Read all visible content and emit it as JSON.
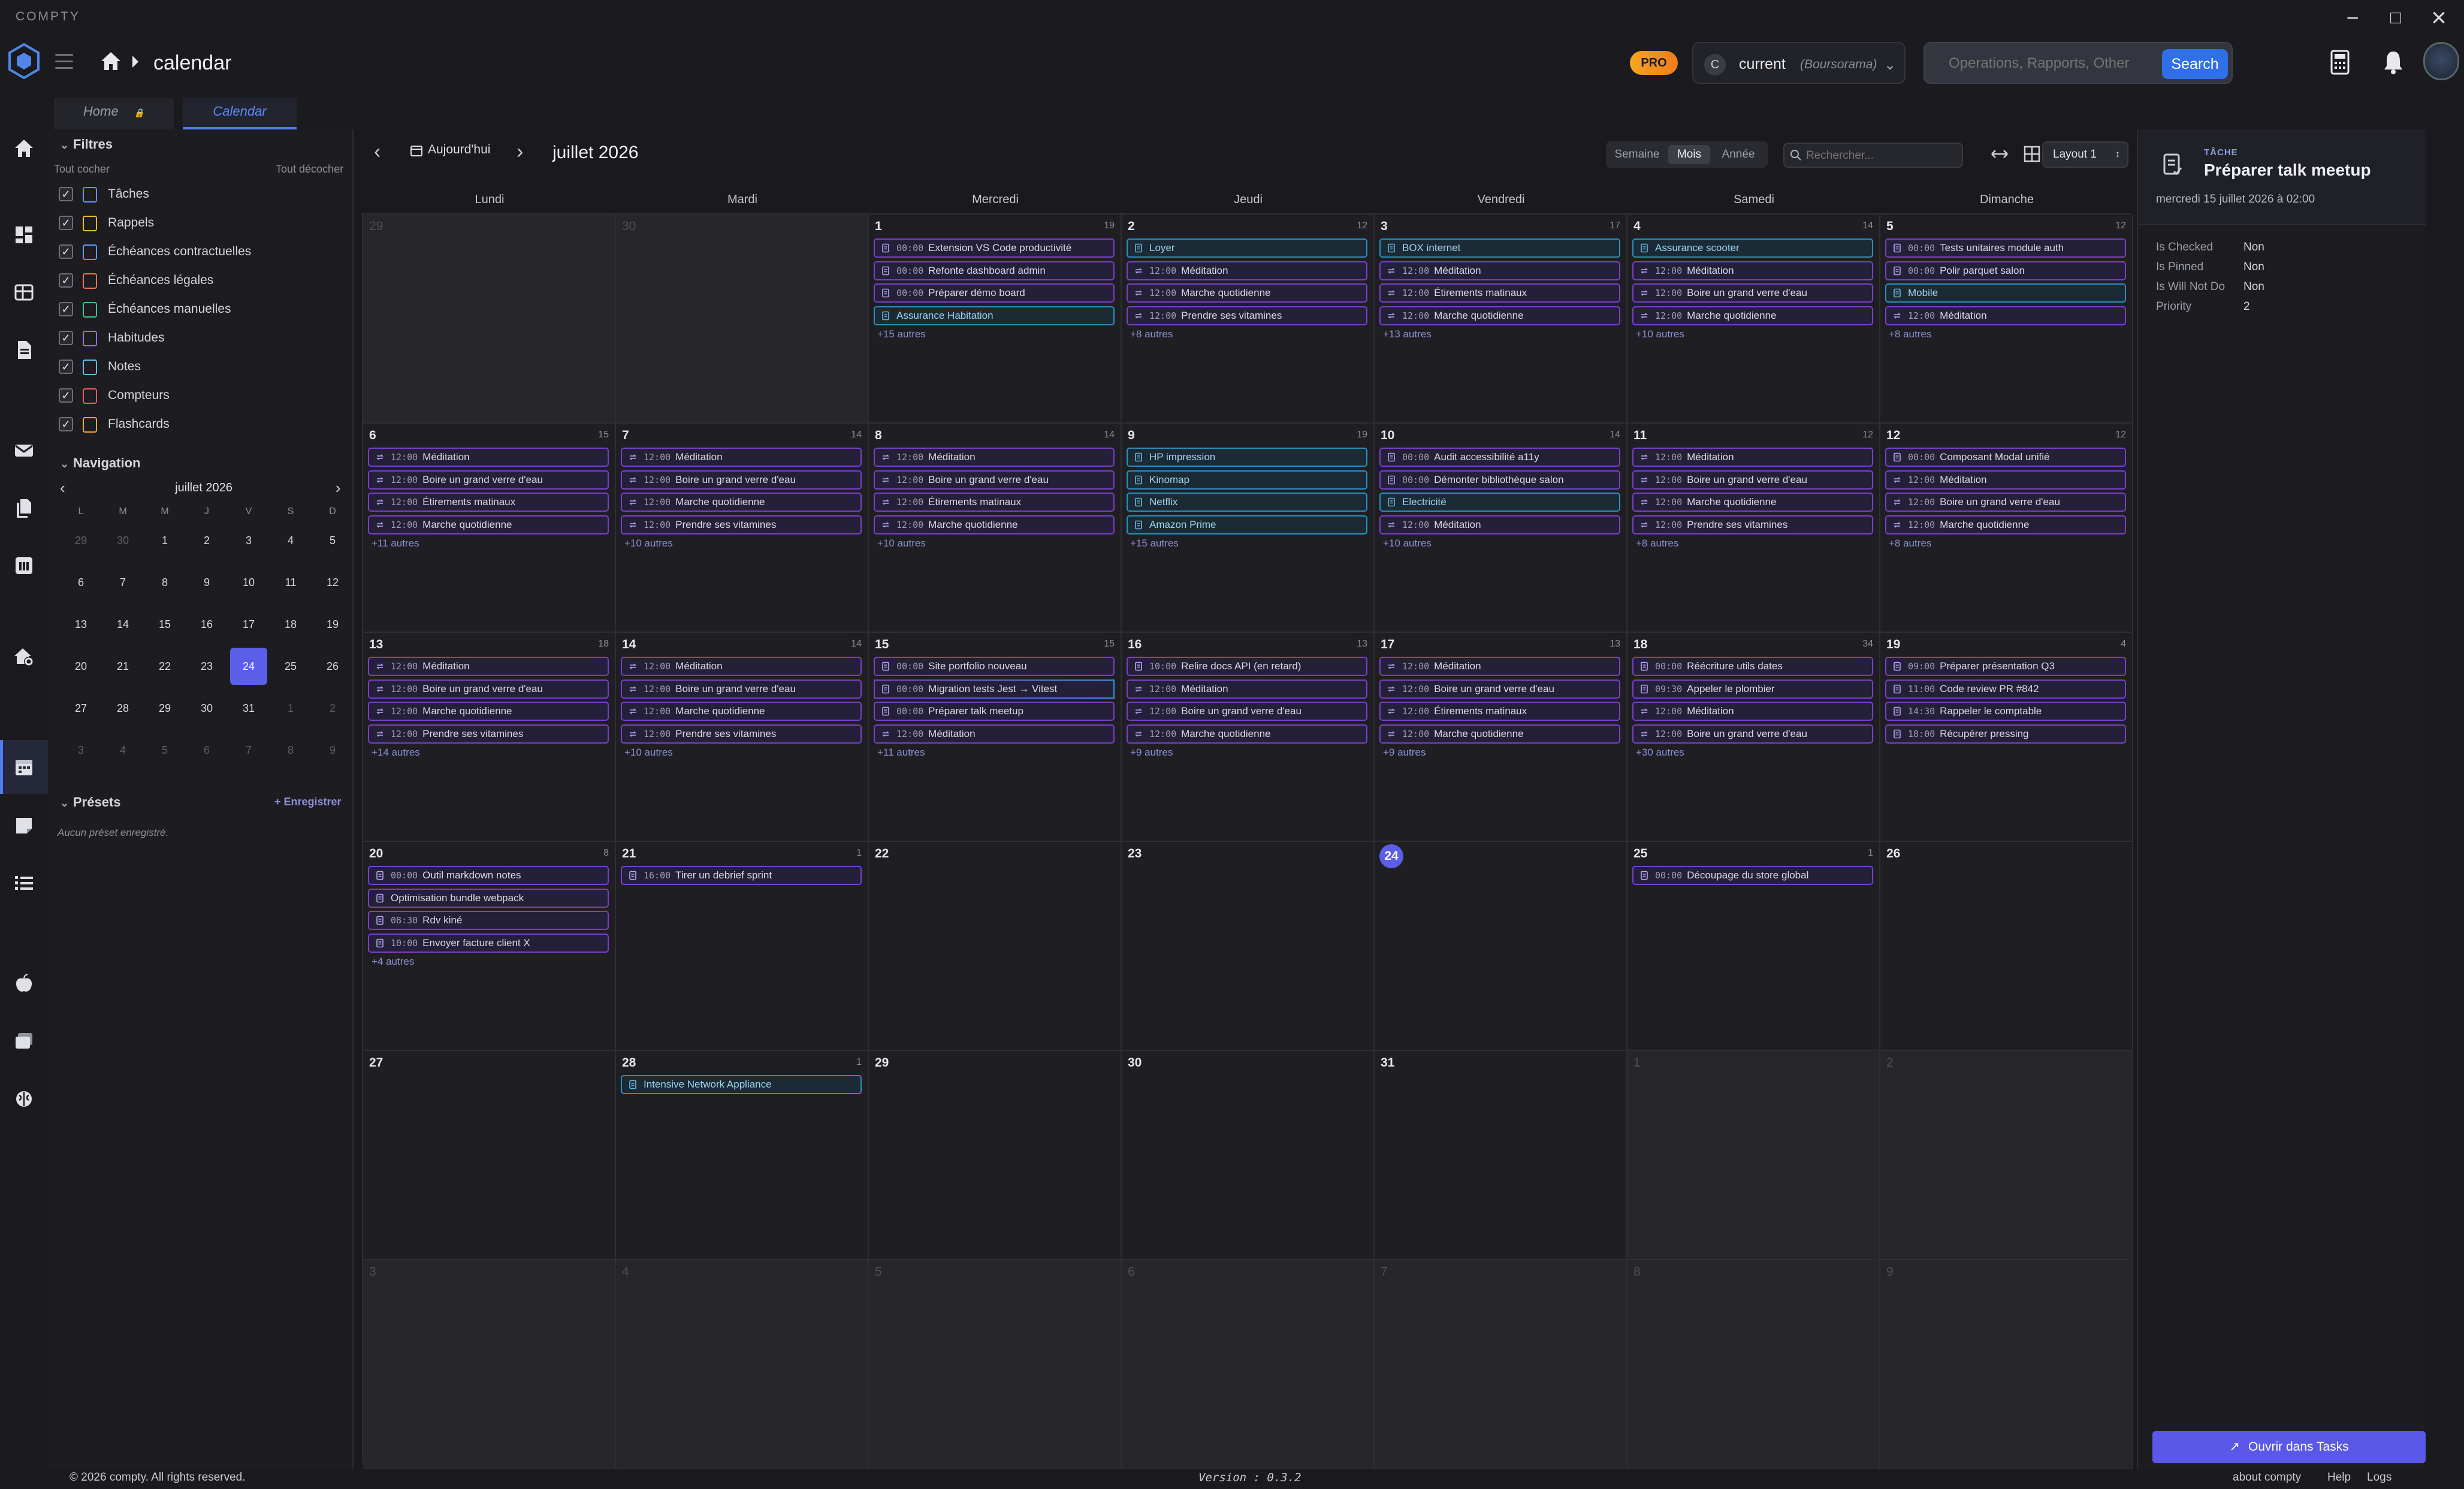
{
  "window": {
    "title": "COMPTY",
    "minimize": "−",
    "maximize": "□",
    "close": "×"
  },
  "header": {
    "breadcrumb": "calendar",
    "pro_badge": "PRO",
    "account": {
      "initial": "C",
      "name": "current",
      "sub": "(Boursorama)"
    },
    "search": {
      "placeholder": "Operations, Rapports, Other",
      "button": "Search"
    }
  },
  "tabs": [
    {
      "label": "Home"
    },
    {
      "label": "Calendar"
    }
  ],
  "filters": {
    "title": "Filtres",
    "check_all": "Tout cocher",
    "uncheck_all": "Tout décocher",
    "items": [
      {
        "label": "Tâches",
        "color": "#6f8cff"
      },
      {
        "label": "Rappels",
        "color": "#f5b731"
      },
      {
        "label": "Échéances contractuelles",
        "color": "#5b9cf0"
      },
      {
        "label": "Échéances légales",
        "color": "#ef7452"
      },
      {
        "label": "Échéances manuelles",
        "color": "#3fc48a"
      },
      {
        "label": "Habitudes",
        "color": "#9b6cf0"
      },
      {
        "label": "Notes",
        "color": "#5bc0e8"
      },
      {
        "label": "Compteurs",
        "color": "#ef5b5b"
      },
      {
        "label": "Flashcards",
        "color": "#f0a340"
      }
    ]
  },
  "navigation": {
    "title": "Navigation",
    "month": "juillet 2026",
    "dows": [
      "L",
      "M",
      "M",
      "J",
      "V",
      "S",
      "D"
    ],
    "weeks": [
      [
        [
          "29",
          1
        ],
        [
          "30",
          1
        ],
        [
          "1",
          0
        ],
        [
          "2",
          0
        ],
        [
          "3",
          0
        ],
        [
          "4",
          0
        ],
        [
          "5",
          0
        ]
      ],
      [
        [
          "6",
          0
        ],
        [
          "7",
          0
        ],
        [
          "8",
          0
        ],
        [
          "9",
          0
        ],
        [
          "10",
          0
        ],
        [
          "11",
          0
        ],
        [
          "12",
          0
        ]
      ],
      [
        [
          "13",
          0
        ],
        [
          "14",
          0
        ],
        [
          "15",
          0
        ],
        [
          "16",
          0
        ],
        [
          "17",
          0
        ],
        [
          "18",
          0
        ],
        [
          "19",
          0
        ]
      ],
      [
        [
          "20",
          0
        ],
        [
          "21",
          0
        ],
        [
          "22",
          0
        ],
        [
          "23",
          0
        ],
        [
          "24",
          2
        ],
        [
          "25",
          0
        ],
        [
          "26",
          0
        ]
      ],
      [
        [
          "27",
          0
        ],
        [
          "28",
          0
        ],
        [
          "29",
          0
        ],
        [
          "30",
          0
        ],
        [
          "31",
          0
        ],
        [
          "1",
          1
        ],
        [
          "2",
          1
        ]
      ],
      [
        [
          "3",
          1
        ],
        [
          "4",
          1
        ],
        [
          "5",
          1
        ],
        [
          "6",
          1
        ],
        [
          "7",
          1
        ],
        [
          "8",
          1
        ],
        [
          "9",
          1
        ]
      ]
    ]
  },
  "presets": {
    "title": "Présets",
    "save": "+ Enregistrer",
    "empty": "Aucun préset enregistré."
  },
  "calendar": {
    "today_label": "Aujourd'hui",
    "month_title": "juillet 2026",
    "views": [
      "Semaine",
      "Mois",
      "Année"
    ],
    "active_view": "Mois",
    "search_placeholder": "Rechercher...",
    "layout": "Layout 1",
    "dows": [
      "Lundi",
      "Mardi",
      "Mercredi",
      "Jeudi",
      "Vendredi",
      "Samedi",
      "Dimanche"
    ],
    "weeks": [
      [
        {
          "day": "29",
          "other": true
        },
        {
          "day": "30",
          "other": true
        },
        {
          "day": "1",
          "count": "19",
          "events": [
            [
              "00:00",
              "Extension VS Code productivité",
              "p"
            ],
            [
              "00:00",
              "Refonte dashboard admin",
              "p"
            ],
            [
              "00:00",
              "Préparer démo board",
              "p"
            ],
            [
              "",
              "Assurance Habitation",
              "b"
            ]
          ],
          "more": "+15 autres"
        },
        {
          "day": "2",
          "count": "12",
          "events": [
            [
              "",
              "Loyer",
              "b"
            ],
            [
              "12:00",
              "Méditation",
              "p"
            ],
            [
              "12:00",
              "Marche quotidienne",
              "p"
            ],
            [
              "12:00",
              "Prendre ses vitamines",
              "p"
            ]
          ],
          "more": "+8 autres"
        },
        {
          "day": "3",
          "count": "17",
          "events": [
            [
              "",
              "BOX internet",
              "b"
            ],
            [
              "12:00",
              "Méditation",
              "p"
            ],
            [
              "12:00",
              "Étirements matinaux",
              "p"
            ],
            [
              "12:00",
              "Marche quotidienne",
              "p"
            ]
          ],
          "more": "+13 autres"
        },
        {
          "day": "4",
          "count": "14",
          "events": [
            [
              "",
              "Assurance scooter",
              "b"
            ],
            [
              "12:00",
              "Méditation",
              "p"
            ],
            [
              "12:00",
              "Boire un grand verre d'eau",
              "p"
            ],
            [
              "12:00",
              "Marche quotidienne",
              "p"
            ]
          ],
          "more": "+10 autres"
        },
        {
          "day": "5",
          "count": "12",
          "events": [
            [
              "00:00",
              "Tests unitaires module auth",
              "p"
            ],
            [
              "00:00",
              "Polir parquet salon",
              "p"
            ],
            [
              "",
              "Mobile",
              "b"
            ],
            [
              "12:00",
              "Méditation",
              "p"
            ]
          ],
          "more": "+8 autres"
        }
      ],
      [
        {
          "day": "6",
          "count": "15",
          "events": [
            [
              "12:00",
              "Méditation",
              "p"
            ],
            [
              "12:00",
              "Boire un grand verre d'eau",
              "p"
            ],
            [
              "12:00",
              "Étirements matinaux",
              "p"
            ],
            [
              "12:00",
              "Marche quotidienne",
              "p"
            ]
          ],
          "more": "+11 autres"
        },
        {
          "day": "7",
          "count": "14",
          "events": [
            [
              "12:00",
              "Méditation",
              "p"
            ],
            [
              "12:00",
              "Boire un grand verre d'eau",
              "p"
            ],
            [
              "12:00",
              "Marche quotidienne",
              "p"
            ],
            [
              "12:00",
              "Prendre ses vitamines",
              "p"
            ]
          ],
          "more": "+10 autres"
        },
        {
          "day": "8",
          "count": "14",
          "events": [
            [
              "12:00",
              "Méditation",
              "p"
            ],
            [
              "12:00",
              "Boire un grand verre d'eau",
              "p"
            ],
            [
              "12:00",
              "Étirements matinaux",
              "p"
            ],
            [
              "12:00",
              "Marche quotidienne",
              "p"
            ]
          ],
          "more": "+10 autres"
        },
        {
          "day": "9",
          "count": "19",
          "events": [
            [
              "",
              "HP impression",
              "b"
            ],
            [
              "",
              "Kinomap",
              "b"
            ],
            [
              "",
              "Netflix",
              "b"
            ],
            [
              "",
              "Amazon Prime",
              "b"
            ]
          ],
          "more": "+15 autres"
        },
        {
          "day": "10",
          "count": "14",
          "events": [
            [
              "00:00",
              "Audit accessibilité a11y",
              "p"
            ],
            [
              "00:00",
              "Démonter bibliothèque salon",
              "p"
            ],
            [
              "",
              "Electricité",
              "b"
            ],
            [
              "12:00",
              "Méditation",
              "p"
            ]
          ],
          "more": "+10 autres"
        },
        {
          "day": "11",
          "count": "12",
          "events": [
            [
              "12:00",
              "Méditation",
              "p"
            ],
            [
              "12:00",
              "Boire un grand verre d'eau",
              "p"
            ],
            [
              "12:00",
              "Marche quotidienne",
              "p"
            ],
            [
              "12:00",
              "Prendre ses vitamines",
              "p"
            ]
          ],
          "more": "+8 autres"
        },
        {
          "day": "12",
          "count": "12",
          "events": [
            [
              "00:00",
              "Composant Modal unifié",
              "p"
            ],
            [
              "12:00",
              "Méditation",
              "p"
            ],
            [
              "12:00",
              "Boire un grand verre d'eau",
              "p"
            ],
            [
              "12:00",
              "Marche quotidienne",
              "p"
            ]
          ],
          "more": "+8 autres"
        }
      ],
      [
        {
          "day": "13",
          "count": "18",
          "events": [
            [
              "12:00",
              "Méditation",
              "p"
            ],
            [
              "12:00",
              "Boire un grand verre d'eau",
              "p"
            ],
            [
              "12:00",
              "Marche quotidienne",
              "p"
            ],
            [
              "12:00",
              "Prendre ses vitamines",
              "p"
            ]
          ],
          "more": "+14 autres"
        },
        {
          "day": "14",
          "count": "14",
          "events": [
            [
              "12:00",
              "Méditation",
              "p"
            ],
            [
              "12:00",
              "Boire un grand verre d'eau",
              "p"
            ],
            [
              "12:00",
              "Marche quotidienne",
              "p"
            ],
            [
              "12:00",
              "Prendre ses vitamines",
              "p"
            ]
          ],
          "more": "+10 autres"
        },
        {
          "day": "15",
          "count": "15",
          "events": [
            [
              "00:00",
              "Site portfolio nouveau",
              "p"
            ],
            [
              "00:00",
              "Migration tests Jest → Vitest",
              "g"
            ],
            [
              "00:00",
              "Préparer talk meetup",
              "p"
            ],
            [
              "12:00",
              "Méditation",
              "p"
            ]
          ],
          "more": "+11 autres"
        },
        {
          "day": "16",
          "count": "13",
          "events": [
            [
              "10:00",
              "Relire docs API (en retard)",
              "p"
            ],
            [
              "12:00",
              "Méditation",
              "p"
            ],
            [
              "12:00",
              "Boire un grand verre d'eau",
              "p"
            ],
            [
              "12:00",
              "Marche quotidienne",
              "p"
            ]
          ],
          "more": "+9 autres"
        },
        {
          "day": "17",
          "count": "13",
          "events": [
            [
              "12:00",
              "Méditation",
              "p"
            ],
            [
              "12:00",
              "Boire un grand verre d'eau",
              "p"
            ],
            [
              "12:00",
              "Étirements matinaux",
              "p"
            ],
            [
              "12:00",
              "Marche quotidienne",
              "p"
            ]
          ],
          "more": "+9 autres"
        },
        {
          "day": "18",
          "count": "34",
          "events": [
            [
              "00:00",
              "Réécriture utils dates",
              "p"
            ],
            [
              "09:30",
              "Appeler le plombier",
              "p"
            ],
            [
              "12:00",
              "Méditation",
              "p"
            ],
            [
              "12:00",
              "Boire un grand verre d'eau",
              "p"
            ]
          ],
          "more": "+30 autres"
        },
        {
          "day": "19",
          "count": "4",
          "events": [
            [
              "09:00",
              "Préparer présentation Q3",
              "p"
            ],
            [
              "11:00",
              "Code review PR #842",
              "p"
            ],
            [
              "14:30",
              "Rappeler le comptable",
              "p"
            ],
            [
              "18:00",
              "Récupérer pressing",
              "p"
            ]
          ]
        }
      ],
      [
        {
          "day": "20",
          "count": "8",
          "events": [
            [
              "00:00",
              "Outil markdown notes",
              "p"
            ],
            [
              "",
              "Optimisation bundle webpack",
              "p"
            ],
            [
              "08:30",
              "Rdv kiné",
              "p"
            ],
            [
              "10:00",
              "Envoyer facture client X",
              "p"
            ]
          ],
          "more": "+4 autres"
        },
        {
          "day": "21",
          "count": "1",
          "events": [
            [
              "16:00",
              "Tirer un debrief sprint",
              "p"
            ]
          ]
        },
        {
          "day": "22"
        },
        {
          "day": "23"
        },
        {
          "day": "24",
          "today": true
        },
        {
          "day": "25",
          "count": "1",
          "events": [
            [
              "00:00",
              "Découpage du store global",
              "p"
            ]
          ]
        },
        {
          "day": "26"
        }
      ],
      [
        {
          "day": "27"
        },
        {
          "day": "28",
          "count": "1",
          "events": [
            [
              "",
              "Intensive Network Appliance",
              "b"
            ]
          ]
        },
        {
          "day": "29"
        },
        {
          "day": "30"
        },
        {
          "day": "31"
        },
        {
          "day": "1",
          "other": true
        },
        {
          "day": "2",
          "other": true
        }
      ],
      [
        {
          "day": "3",
          "other": true
        },
        {
          "day": "4",
          "other": true
        },
        {
          "day": "5",
          "other": true
        },
        {
          "day": "6",
          "other": true
        },
        {
          "day": "7",
          "other": true
        },
        {
          "day": "8",
          "other": true
        },
        {
          "day": "9",
          "other": true
        }
      ]
    ]
  },
  "detail": {
    "type": "TÂCHE",
    "title": "Préparer talk meetup",
    "date": "mercredi 15 juillet 2026 à 02:00",
    "fields": [
      {
        "k": "Is Checked",
        "v": "Non"
      },
      {
        "k": "Is Pinned",
        "v": "Non"
      },
      {
        "k": "Is Will Not Do",
        "v": "Non"
      },
      {
        "k": "Priority",
        "v": "2"
      }
    ],
    "open_button": "Ouvrir dans Tasks"
  },
  "footer": {
    "copyright": "© 2026 compty. All rights reserved.",
    "version": "Version : 0.3.2",
    "links": [
      "about compty",
      "Help",
      "Logs"
    ]
  },
  "colors": {
    "accent": "#5b5ee8",
    "event_purple": "#7a3fc8",
    "event_blue": "#2a8fbf",
    "pro": "#f5a623"
  },
  "rail_icons": [
    "home-icon",
    "dashboard-icon",
    "grid-icon",
    "document-icon",
    "mail-icon",
    "files-icon",
    "bank-icon",
    "house-settings-icon",
    "calendar-icon",
    "notes-icon",
    "checklist-icon",
    "apple-icon",
    "cards-icon",
    "brain-icon"
  ]
}
